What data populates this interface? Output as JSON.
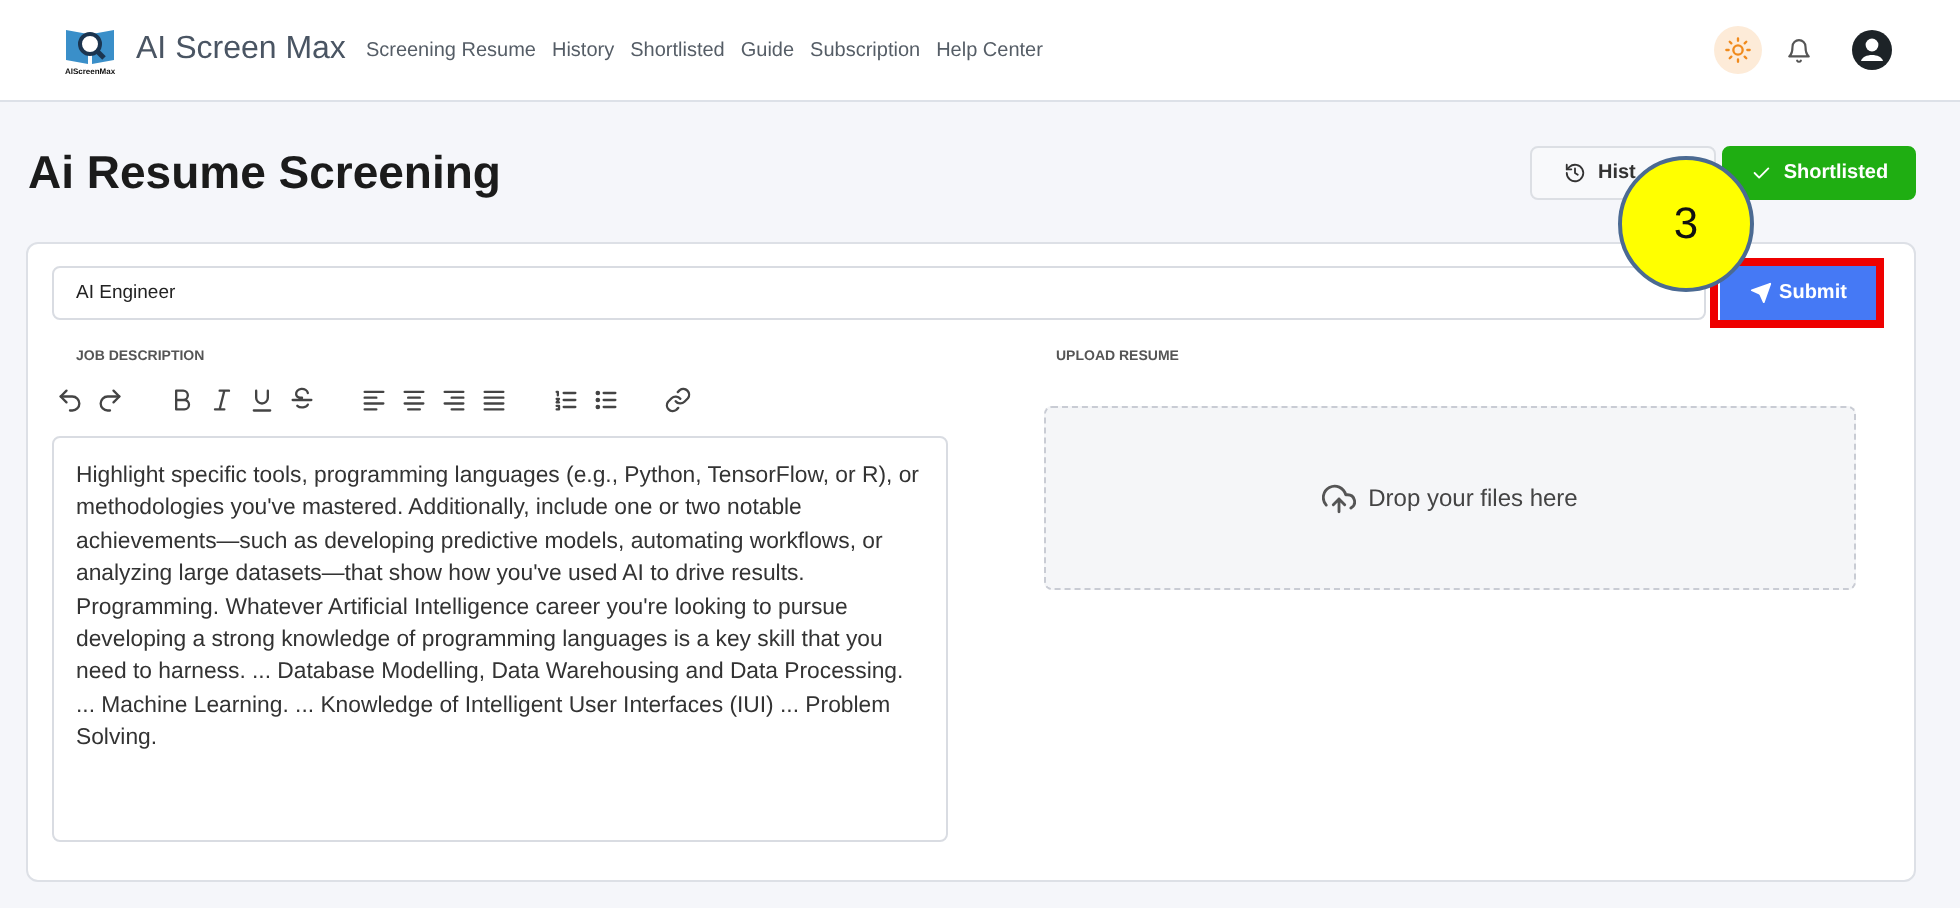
{
  "header": {
    "logo_caption": "AIScreenMax",
    "brand": "AI Screen Max",
    "nav": [
      "Screening Resume",
      "History",
      "Shortlisted",
      "Guide",
      "Subscription",
      "Help Center"
    ]
  },
  "page": {
    "title": "Ai Resume Screening",
    "actions": [
      {
        "label": "Hist",
        "kind": "outline"
      },
      {
        "label": "Shortlisted",
        "kind": "success"
      }
    ]
  },
  "form": {
    "job_title": "AI Engineer",
    "submit": "Submit",
    "callout": "3",
    "job_description": {
      "label": "JOB DESCRIPTION",
      "text": "Highlight specific tools, programming languages (e.g., Python, TensorFlow, or R), or methodologies you've mastered. Additionally, include one or two notable achievements—such as developing predictive models, automating workflows, or analyzing large datasets—that show how you've used AI to drive results. Programming. Whatever Artificial Intelligence career you're looking to pursue developing a strong knowledge of programming languages is a key skill that you need to harness. ... Database Modelling, Data Warehousing and Data Processing. ... Machine Learning. ... Knowledge of Intelligent User Interfaces (IUI) ... Problem Solving."
    },
    "upload": {
      "label": "UPLOAD RESUME",
      "dropzone": "Drop your files here"
    }
  }
}
